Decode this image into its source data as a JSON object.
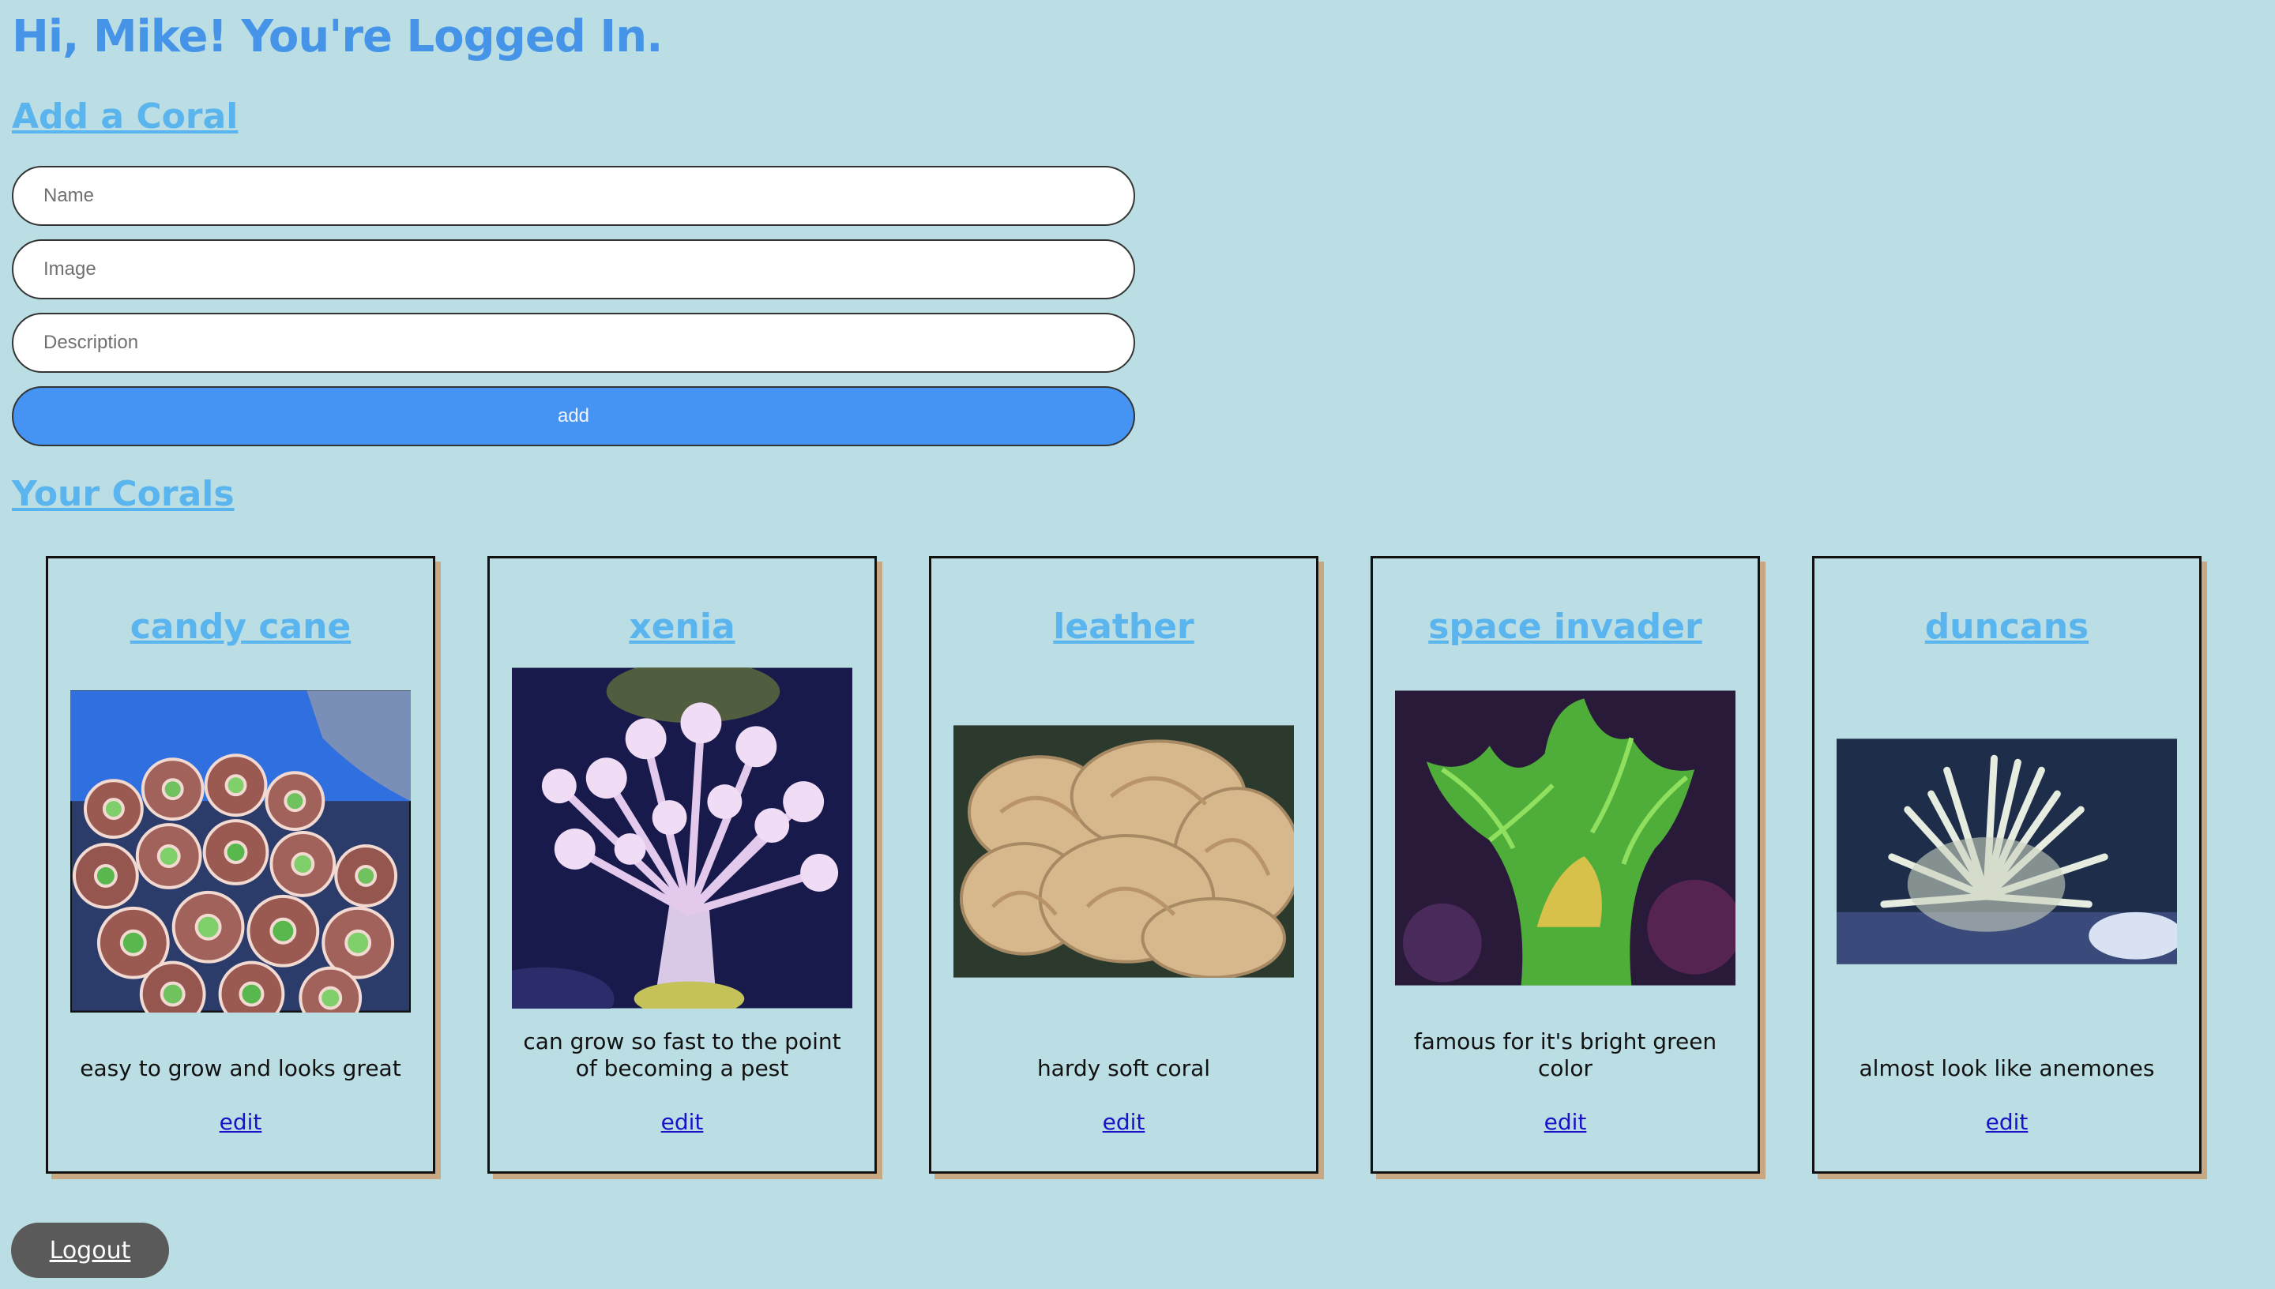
{
  "header": {
    "greeting": "Hi, Mike! You're Logged In."
  },
  "add_form": {
    "heading": "Add a Coral",
    "name_placeholder": "Name",
    "image_placeholder": "Image",
    "description_placeholder": "Description",
    "add_label": "add"
  },
  "corals": {
    "heading": "Your Corals",
    "items": [
      {
        "name": "candy cane",
        "description": "easy to grow and looks great",
        "edit_label": "edit"
      },
      {
        "name": "xenia",
        "description": "can grow so fast to the point of becoming a pest",
        "edit_label": "edit"
      },
      {
        "name": "leather",
        "description": "hardy soft coral",
        "edit_label": "edit"
      },
      {
        "name": "space invader",
        "description": "famous for it's bright green color",
        "edit_label": "edit"
      },
      {
        "name": "duncans",
        "description": "almost look like anemones",
        "edit_label": "edit"
      }
    ]
  },
  "footer": {
    "logout_label": "Logout"
  },
  "colors": {
    "background": "#badee3",
    "accent": "#4594e8",
    "link": "#1a12c8",
    "button": "#4593f2"
  }
}
